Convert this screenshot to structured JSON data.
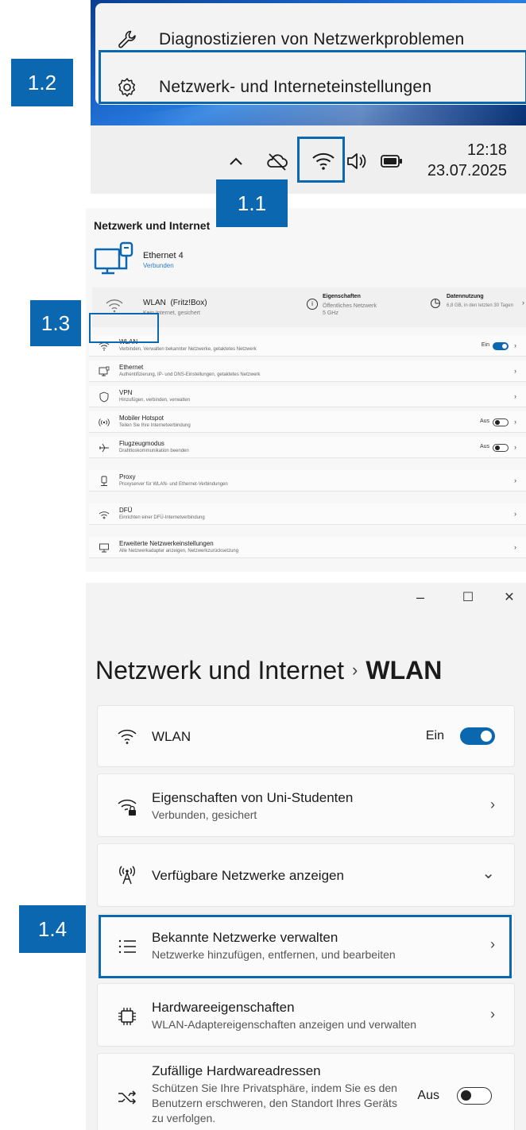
{
  "callouts": {
    "c1_1": "1.1",
    "c1_2": "1.2",
    "c1_3": "1.3",
    "c1_4": "1.4"
  },
  "context_menu": {
    "items": [
      {
        "label": "Diagnostizieren von Netzwerkproblemen",
        "icon": "wrench-icon"
      },
      {
        "label": "Netzwerk- und Interneteinstellungen",
        "icon": "gear-icon"
      }
    ]
  },
  "taskbar": {
    "icons": [
      "chevron-up-icon",
      "cloud-offline-icon",
      "wifi-icon",
      "speaker-icon",
      "battery-icon"
    ],
    "time": "12:18",
    "date": "23.07.2025"
  },
  "overview": {
    "title": "Netzwerk und Internet",
    "ethernet": {
      "name": "Ethernet 4",
      "status": "Verbunden"
    },
    "wlan_card": {
      "name": "WLAN",
      "ssid": "(Fritz!Box)",
      "status": "Kein Internet, gesichert",
      "properties_title": "Eigenschaften",
      "properties_sub1": "Öffentliches Netzwerk",
      "properties_sub2": "5 GHz",
      "usage_title": "Datennutzung",
      "usage_sub": "6,8 GB, in den letzten 30 Tagen"
    },
    "rows": [
      {
        "title": "WLAN",
        "sub": "Verbinden, Verwalten bekannter Netzwerke, getaktetes Netzwerk",
        "state": "Ein",
        "icon": "wifi-icon"
      },
      {
        "title": "Ethernet",
        "sub": "Authentifizierung, IP- und DNS-Einstellungen, getaktetes Netzwerk",
        "icon": "ethernet-icon"
      },
      {
        "title": "VPN",
        "sub": "Hinzufügen, verbinden, verwalten",
        "icon": "shield-icon"
      },
      {
        "title": "Mobiler Hotspot",
        "sub": "Teilen Sie Ihre Internetverbindung",
        "state": "Aus",
        "icon": "hotspot-icon"
      },
      {
        "title": "Flugzeugmodus",
        "sub": "Drahtloskommunikation beenden",
        "state": "Aus",
        "icon": "airplane-icon"
      },
      {
        "title": "Proxy",
        "sub": "Proxyserver für WLAN- und Ethernet-Verbindungen",
        "icon": "proxy-icon"
      },
      {
        "title": "DFÜ",
        "sub": "Einrichten einer DFÜ-Internetverbindung",
        "icon": "dialup-icon"
      },
      {
        "title": "Erweiterte Netzwerkeinstellungen",
        "sub": "Alle Netzwerkadapter anzeigen, Netzwerkzurücksetzung",
        "icon": "network-adapter-icon"
      }
    ]
  },
  "window": {
    "controls": {
      "minimize": "–",
      "maximize": "☐",
      "close": "✕"
    },
    "breadcrumb_parent": "Netzwerk und Internet",
    "breadcrumb_sep": "›",
    "breadcrumb_current": "WLAN",
    "wlan_label": "WLAN",
    "wlan_state": "Ein",
    "properties": {
      "title": "Eigenschaften von Uni-Studenten",
      "sub": "Verbunden, gesichert"
    },
    "available": {
      "title": "Verfügbare Netzwerke anzeigen"
    },
    "known": {
      "title": "Bekannte Netzwerke verwalten",
      "sub": "Netzwerke hinzufügen, entfernen, und bearbeiten"
    },
    "hardware": {
      "title": "Hardwareeigenschaften",
      "sub": "WLAN-Adaptereigenschaften anzeigen und verwalten"
    },
    "random": {
      "title": "Zufällige Hardwareadressen",
      "sub": "Schützen Sie Ihre Privatsphäre, indem Sie es den Benutzern erschweren, den Standort Ihres Geräts zu verfolgen.",
      "state": "Aus"
    },
    "chevron_right": "›",
    "chevron_down": "⌄"
  },
  "colors": {
    "accent": "#0c67b1"
  }
}
